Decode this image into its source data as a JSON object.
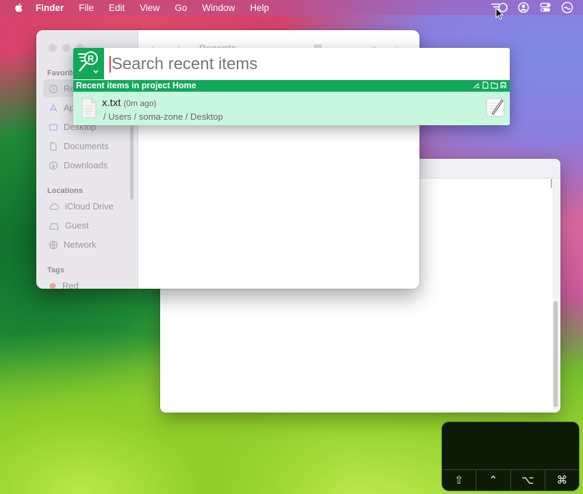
{
  "menubar": {
    "app": "Finder",
    "items": [
      "File",
      "Edit",
      "View",
      "Go",
      "Window",
      "Help"
    ],
    "status_icons": [
      "recents-menu-icon",
      "user-icon",
      "control-center-icon",
      "siri-icon"
    ]
  },
  "finder": {
    "title": "Recents",
    "sidebar": {
      "favorites_head": "Favorites",
      "favorites": [
        "Recents",
        "Applications",
        "Desktop",
        "Documents",
        "Downloads"
      ],
      "locations_head": "Locations",
      "locations": [
        "iCloud Drive",
        "Guest",
        "Network"
      ],
      "tags_head": "Tags",
      "tags": [
        "Red"
      ]
    }
  },
  "overlay": {
    "search_placeholder": "Search recent items",
    "header": "Recent items in project Home",
    "result": {
      "name": "x.txt",
      "age": "(0m ago)",
      "path": "/ Users / soma-zone / Desktop"
    }
  },
  "hud": {
    "keys": [
      "⇧",
      "⌃",
      "⌥",
      "⌘"
    ]
  },
  "colors": {
    "accent_green": "#12a85a",
    "row_highlight": "#c9f6df"
  }
}
